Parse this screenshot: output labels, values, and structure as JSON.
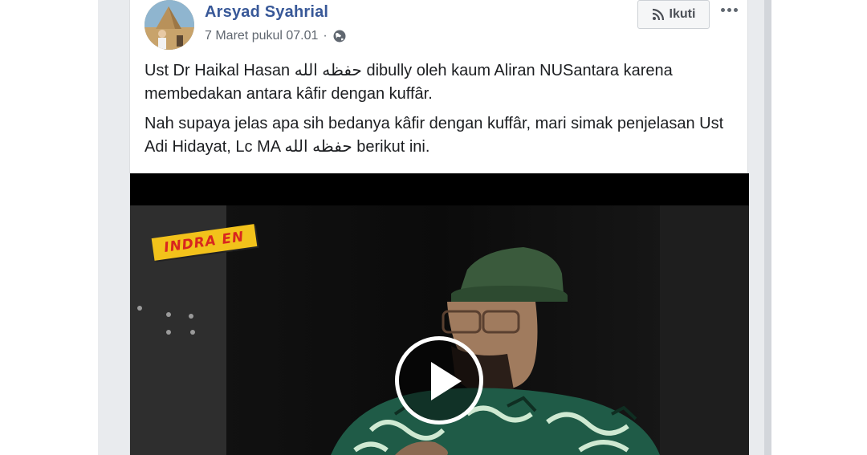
{
  "post": {
    "author": "Arsyad Syahrial",
    "timestamp": "7 Maret pukul 07.01",
    "separator": "·",
    "privacy_icon": "globe-icon",
    "follow_label": "Ikuti",
    "follow_icon": "rss-icon",
    "more_icon": "more-options-icon",
    "paragraphs": [
      "Ust Dr Haikal Hasan حفظه الله dibully oleh kaum Aliran NUSantara karena membedakan antara kâfir dengan kuffâr.",
      "Nah supaya jelas apa sih bedanya kâfir dengan kuffâr, mari simak penjelasan Ust Adi Hidayat, Lc MA حفظه الله berikut ini."
    ]
  },
  "video": {
    "watermark": "INDRA EN",
    "play_icon": "play-icon"
  },
  "colors": {
    "author_link": "#385898",
    "meta_text": "#606770",
    "body_text": "#1c1e21",
    "feed_background": "#e9ebee",
    "watermark_bg": "#f2c21b",
    "watermark_text": "#d8261f"
  }
}
